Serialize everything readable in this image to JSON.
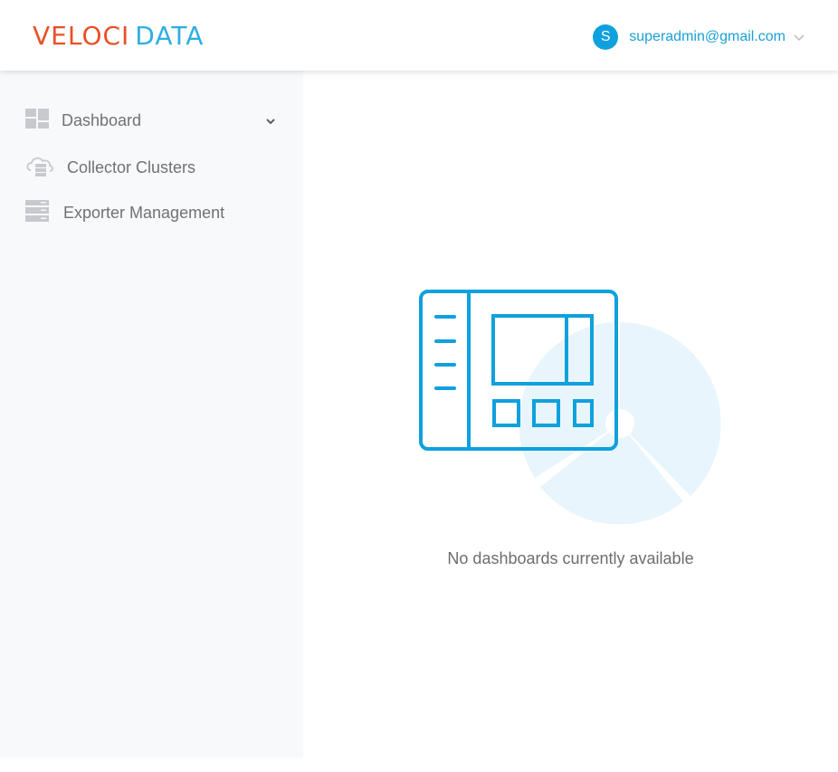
{
  "header": {
    "logo_part1": "VELOCI",
    "logo_part2": "DATA",
    "user": {
      "avatar_letter": "S",
      "email": "superadmin@gmail.com"
    }
  },
  "sidebar": {
    "items": [
      {
        "label": "Dashboard",
        "icon": "dashboard-grid-icon",
        "has_submenu": true
      },
      {
        "label": "Collector Clusters",
        "icon": "cloud-server-icon"
      },
      {
        "label": "Exporter Management",
        "icon": "server-stack-icon"
      }
    ]
  },
  "main": {
    "empty_message": "No dashboards currently available",
    "illustration": "dashboard-empty-icon"
  },
  "colors": {
    "brand_orange": "#e8502a",
    "brand_blue": "#2eaee3",
    "accent": "#0ea1dd",
    "sidebar_bg": "#f8f9fb",
    "icon_gray": "#c6c9cd"
  }
}
